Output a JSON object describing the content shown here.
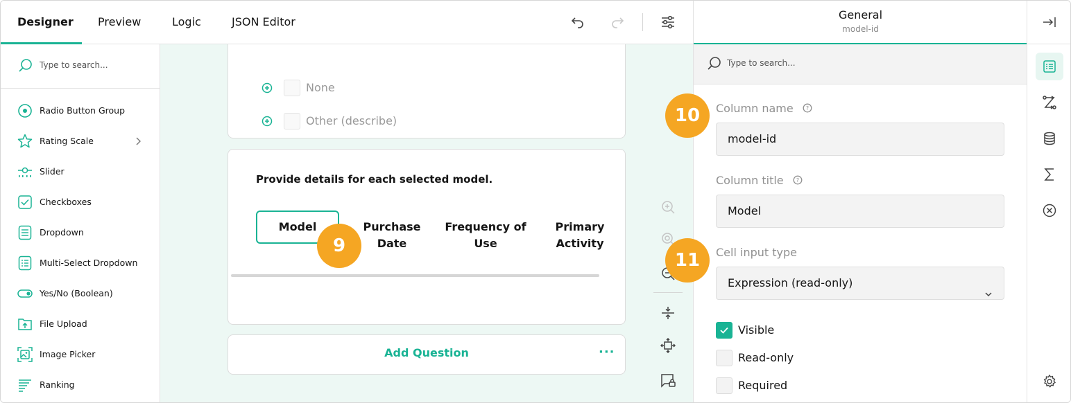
{
  "colors": {
    "accent": "#19b394",
    "badge": "#f5a623"
  },
  "tabs": [
    {
      "label": "Designer",
      "active": true
    },
    {
      "label": "Preview"
    },
    {
      "label": "Logic"
    },
    {
      "label": "JSON Editor"
    }
  ],
  "toolbar_icons": [
    "undo-icon",
    "redo-icon",
    "settings-sliders-icon"
  ],
  "toolbox": {
    "search_placeholder": "Type to search...",
    "items": [
      {
        "label": "Radio Button Group",
        "icon": "radio-icon"
      },
      {
        "label": "Rating Scale",
        "icon": "star-icon",
        "has_submenu": true
      },
      {
        "label": "Slider",
        "icon": "slider-icon"
      },
      {
        "label": "Checkboxes",
        "icon": "checkbox-icon"
      },
      {
        "label": "Dropdown",
        "icon": "dropdown-icon"
      },
      {
        "label": "Multi-Select Dropdown",
        "icon": "multi-dropdown-icon"
      },
      {
        "label": "Yes/No (Boolean)",
        "icon": "toggle-icon"
      },
      {
        "label": "File Upload",
        "icon": "file-upload-icon"
      },
      {
        "label": "Image Picker",
        "icon": "image-picker-icon"
      },
      {
        "label": "Ranking",
        "icon": "ranking-icon"
      }
    ]
  },
  "canvas": {
    "choices": [
      {
        "label": "None"
      },
      {
        "label": "Other (describe)"
      }
    ],
    "question": {
      "title": "Provide details for each selected model.",
      "columns": [
        {
          "line1": "Model",
          "line2": "",
          "selected": true
        },
        {
          "line1": "Purchase",
          "line2": "Date"
        },
        {
          "line1": "Frequency of",
          "line2": "Use"
        },
        {
          "line1": "Primary",
          "line2": "Activity"
        }
      ]
    },
    "add_question_label": "Add Question",
    "more_label": "···"
  },
  "badges": {
    "b9": "9",
    "b10": "10",
    "b11": "11"
  },
  "property_grid": {
    "title": "General",
    "subtitle": "model-id",
    "search_placeholder": "Type to search...",
    "column_name_label": "Column name",
    "column_name_value": "model-id",
    "column_title_label": "Column title",
    "column_title_value": "Model",
    "cell_input_type_label": "Cell input type",
    "cell_input_type_value": "Expression (read-only)",
    "checkboxes": [
      {
        "label": "Visible",
        "checked": true
      },
      {
        "label": "Read-only",
        "checked": false
      },
      {
        "label": "Required",
        "checked": false
      }
    ]
  },
  "rail_icons": [
    "collapse-panel-icon",
    "properties-icon",
    "logic-icon",
    "data-icon",
    "sum-icon",
    "clear-icon",
    "settings-icon"
  ]
}
